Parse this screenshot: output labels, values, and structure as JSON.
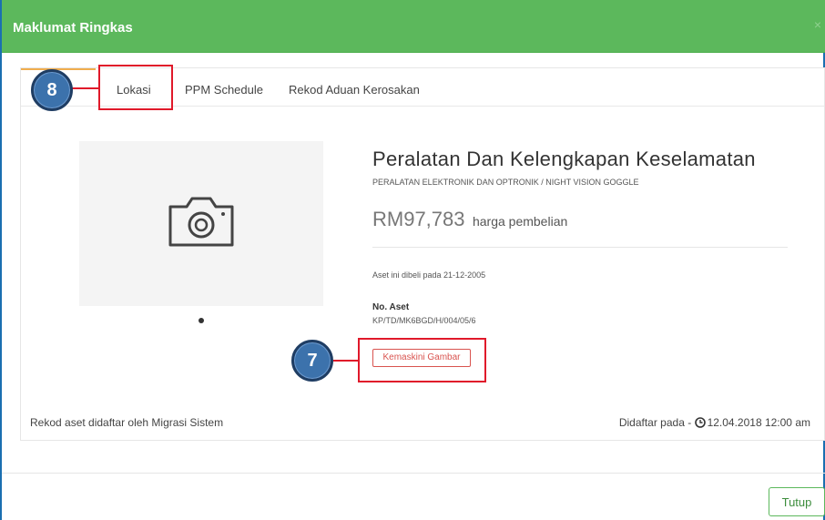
{
  "modal": {
    "title": "Maklumat Ringkas",
    "close_glyph": "×"
  },
  "tabs": [
    {
      "label": "Lokasi"
    },
    {
      "label": "PPM Schedule"
    },
    {
      "label": "Rekod Aduan Kerosakan"
    }
  ],
  "asset": {
    "title": "Peralatan Dan Kelengkapan Keselamatan",
    "subtitle": "PERALATAN ELEKTRONIK DAN OPTRONIK / NIGHT VISION GOGGLE",
    "price": "RM97,783",
    "price_label": "harga pembelian",
    "purchase_date_text": "Aset ini dibeli pada 21-12-2005",
    "asset_no_label": "No. Aset",
    "asset_no_value": "KP/TD/MK6BGD/H/004/05/6",
    "update_photo_label": "Kemaskini Gambar",
    "image_icon": "camera-icon"
  },
  "footer": {
    "registered_by": "Rekod aset didaftar oleh Migrasi Sistem",
    "registered_on_label": "Didaftar pada -",
    "registered_on_value": "12.04.2018 12:00 am",
    "close_label": "Tutup"
  },
  "callouts": [
    {
      "number": "8",
      "target": "tab-lokasi"
    },
    {
      "number": "7",
      "target": "update-photo-button"
    }
  ],
  "colors": {
    "header": "#5cb85c",
    "accent_tab": "#f0ad4e",
    "danger": "#d9534f",
    "callout_red": "#e0192a",
    "callout_badge": "#3c72ac"
  }
}
